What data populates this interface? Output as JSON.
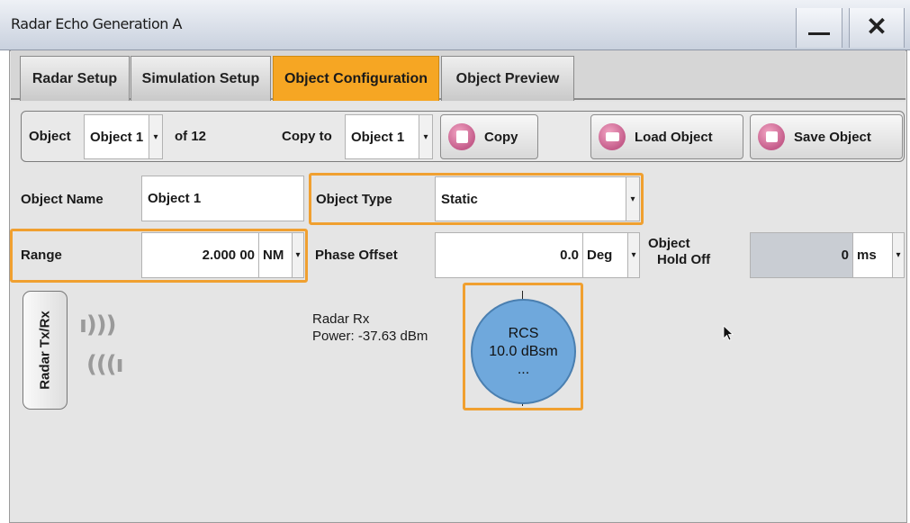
{
  "window": {
    "title": "Radar Echo Generation A",
    "minimize_label": "—",
    "close_label": "✕"
  },
  "tabs": [
    {
      "label": "Radar Setup"
    },
    {
      "label": "Simulation Setup"
    },
    {
      "label": "Object Configuration",
      "active": true
    },
    {
      "label": "Object Preview"
    }
  ],
  "object_row": {
    "object_label": "Object",
    "object_value": "Object 1",
    "of_label": "of 12",
    "copy_to_label": "Copy to",
    "copy_to_value": "Object 1",
    "copy_button": "Copy",
    "load_button": "Load Object",
    "save_button": "Save Object"
  },
  "fields": {
    "object_name_label": "Object Name",
    "object_name_value": "Object 1",
    "object_type_label": "Object Type",
    "object_type_value": "Static",
    "range_label": "Range",
    "range_value": "2.000 00",
    "range_unit": "NM",
    "phase_offset_label": "Phase Offset",
    "phase_offset_value": "0.0",
    "phase_offset_unit": "Deg",
    "hold_off_label_1": "Object",
    "hold_off_label_2": "Hold Off",
    "hold_off_value": "0",
    "hold_off_unit": "ms"
  },
  "diagram": {
    "radar_button": "Radar Tx/Rx",
    "tx_wave": "ı)))",
    "rx_wave": "(((ı",
    "rx_label_1": "Radar Rx",
    "rx_label_2": "Power: -37.63 dBm",
    "rcs_title": "RCS",
    "rcs_value": "10.0 dBsm",
    "rcs_more": "..."
  },
  "colors": {
    "accent": "#f0a030",
    "active_tab": "#f6a623",
    "rcs_fill": "#6fa8dc"
  }
}
